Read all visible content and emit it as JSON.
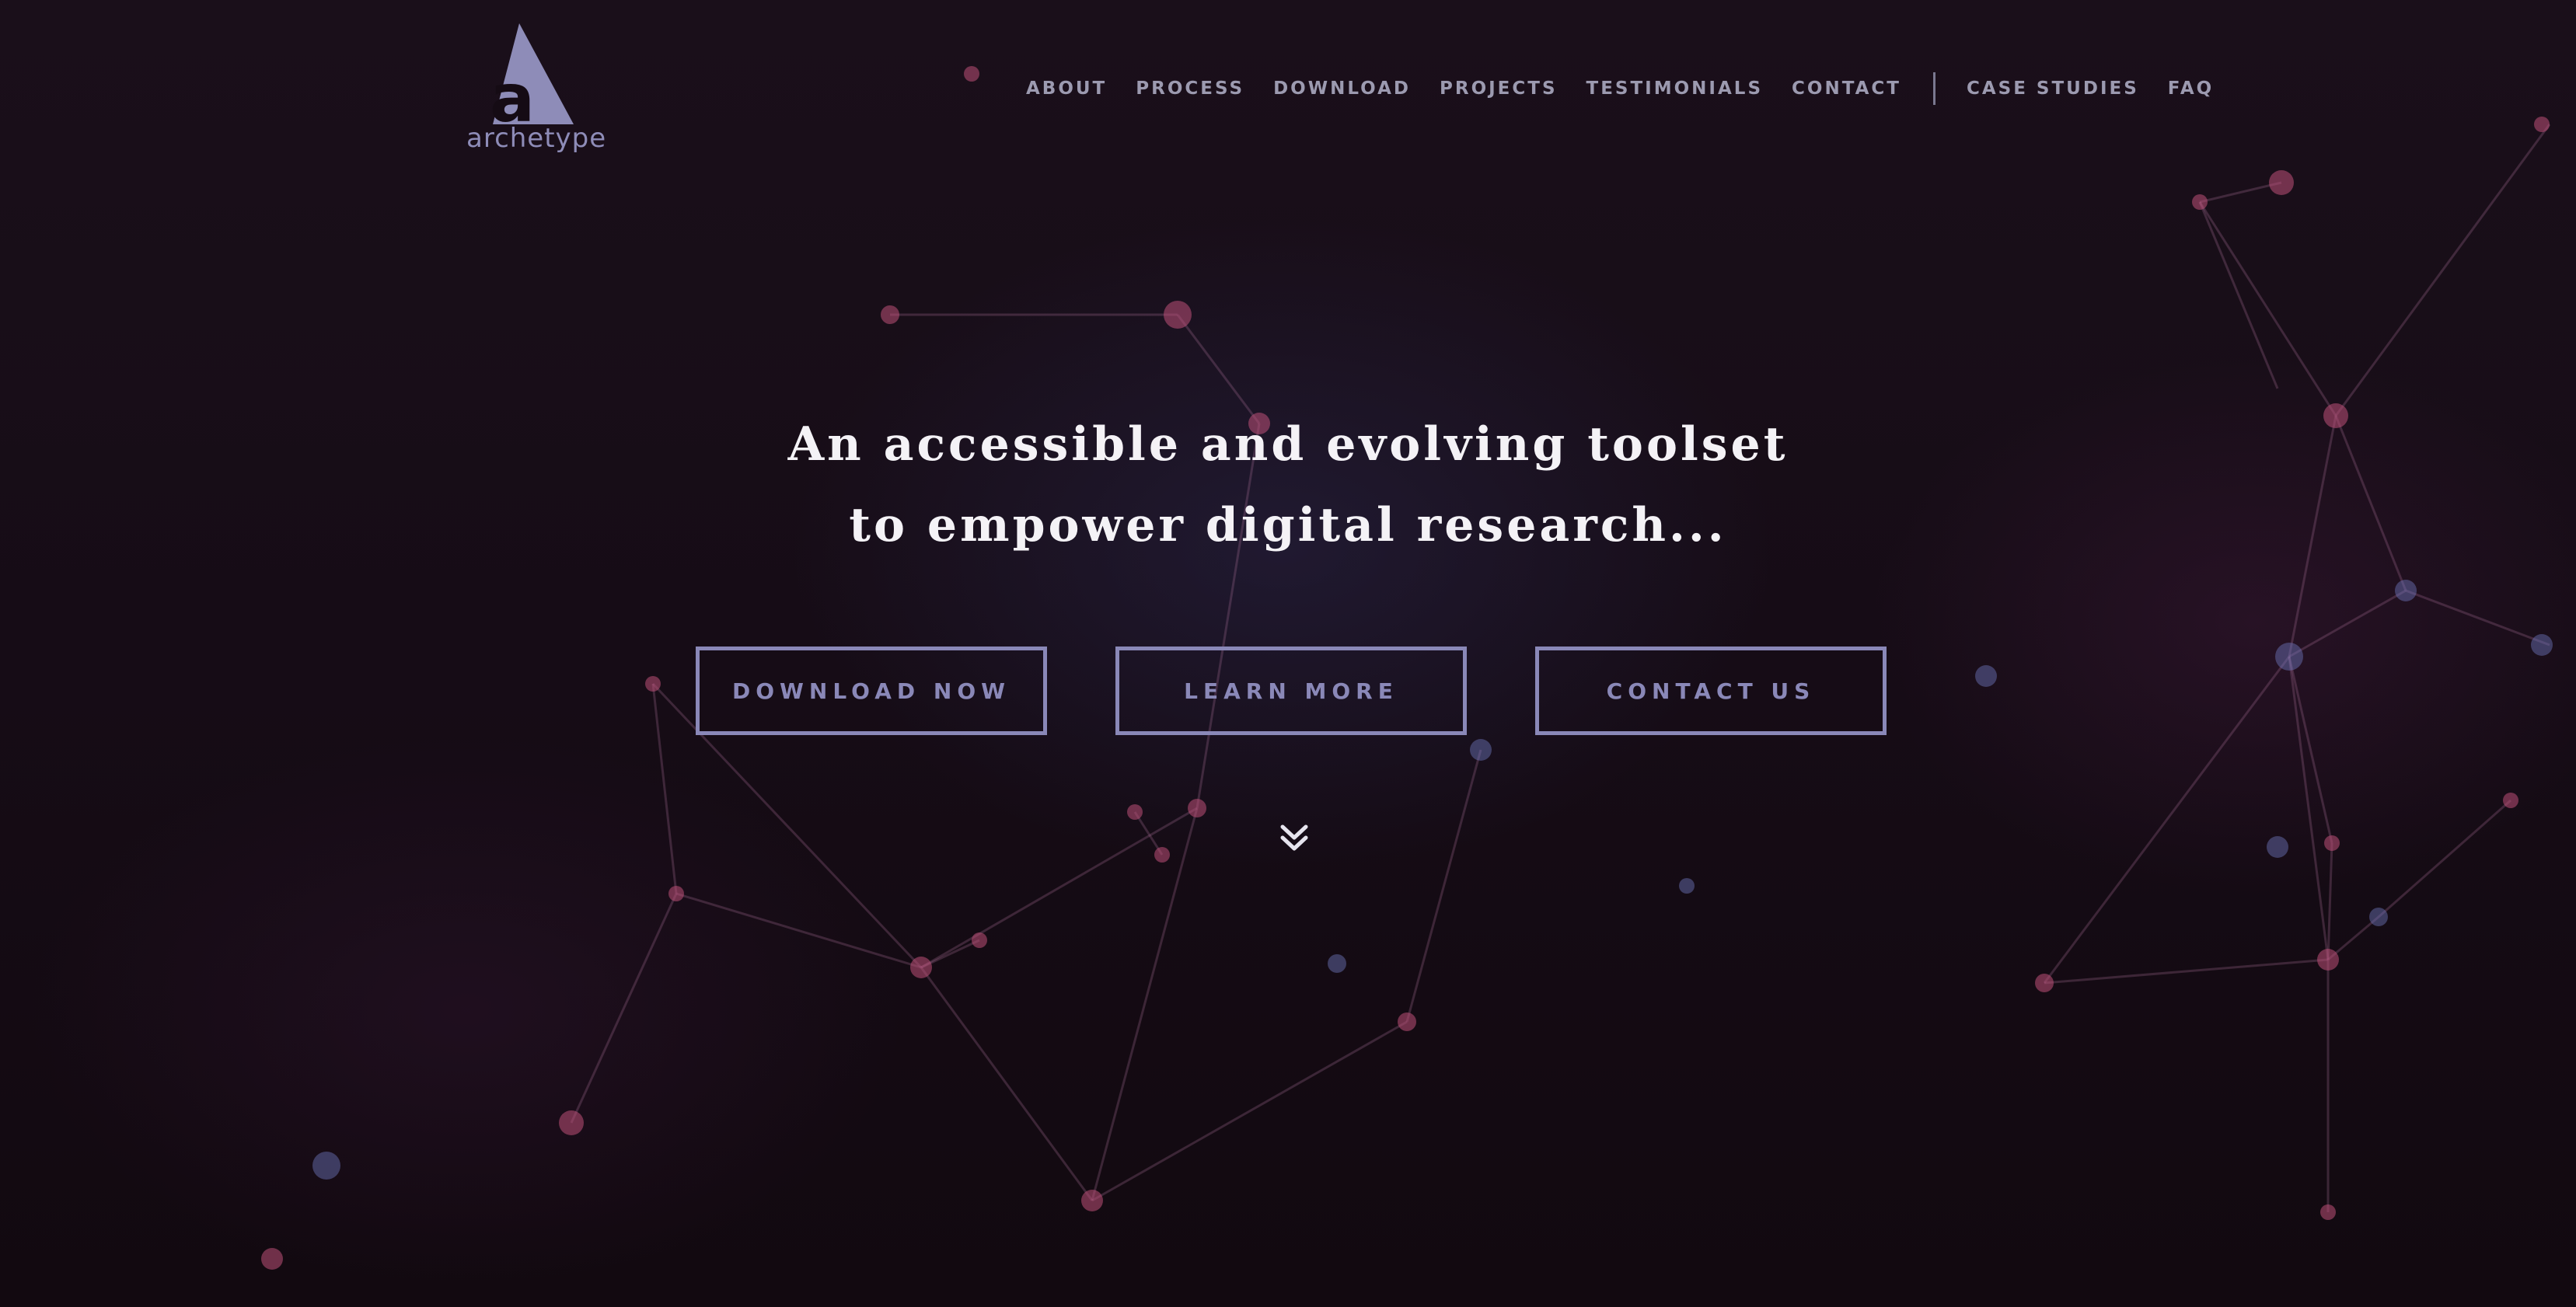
{
  "header": {
    "logo_text": "archetype",
    "nav": [
      {
        "label": "ABOUT"
      },
      {
        "label": "PROCESS"
      },
      {
        "label": "DOWNLOAD"
      },
      {
        "label": "PROJECTS"
      },
      {
        "label": "TESTIMONIALS"
      },
      {
        "label": "CONTACT"
      }
    ],
    "nav_secondary": [
      {
        "label": "CASE STUDIES"
      },
      {
        "label": "FAQ"
      }
    ]
  },
  "hero": {
    "title_line_1": "An accessible and evolving toolset",
    "title_line_2": "to empower digital research...",
    "buttons": {
      "download": "DOWNLOAD NOW",
      "learn": "LEARN MORE",
      "contact": "CONTACT US"
    },
    "scroll_icon": "double-chevron-down-icon"
  },
  "colors": {
    "background": "#150b14",
    "accent": "#8a88b8",
    "nav_text": "#9c9ab0",
    "title_text": "#f4f2f6"
  }
}
